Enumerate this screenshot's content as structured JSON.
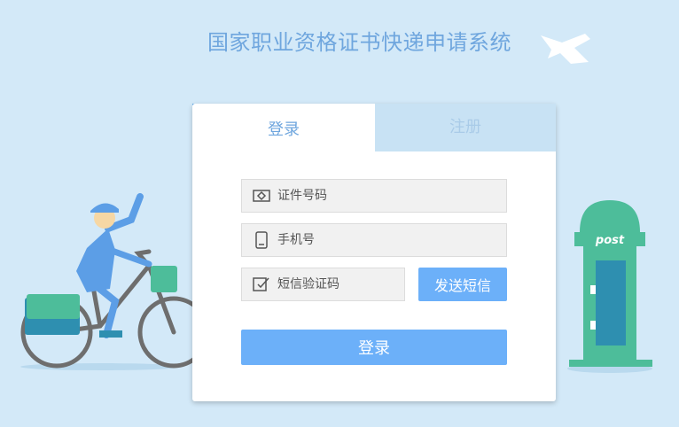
{
  "header": {
    "title": "国家职业资格证书快递申请系统"
  },
  "tabs": {
    "login": "登录",
    "register": "注册"
  },
  "form": {
    "id_placeholder": "证件号码",
    "phone_placeholder": "手机号",
    "sms_placeholder": "短信验证码",
    "send_sms_label": "发送短信",
    "login_label": "登录"
  },
  "illustration": {
    "postbox_text": "post"
  },
  "colors": {
    "background": "#d3e9f8",
    "accent": "#6cb0f9",
    "title": "#6fa6de",
    "teal": "#4dbd9a"
  }
}
